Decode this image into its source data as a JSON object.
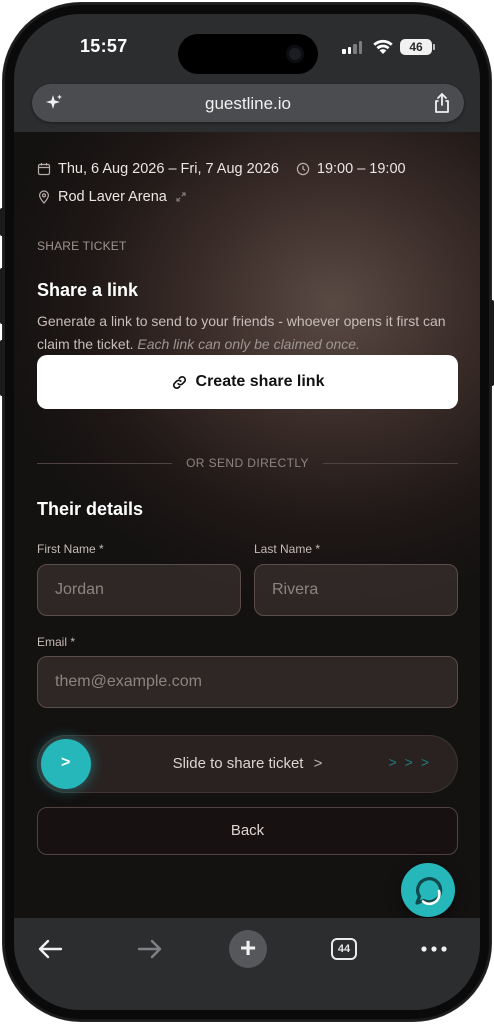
{
  "status_bar": {
    "time": "15:57",
    "battery": "46"
  },
  "browser": {
    "url": "guestline.io"
  },
  "event": {
    "dates": "Thu, 6 Aug 2026 – Fri, 7 Aug 2026",
    "time": "19:00 – 19:00",
    "venue": "Rod Laver Arena"
  },
  "share": {
    "section_label": "SHARE TICKET",
    "heading": "Share a link",
    "description": "Generate a link to send to your friends - whoever opens it first can claim the ticket.",
    "description_note": "Each link can only be claimed once.",
    "create_button_label": "Create share link"
  },
  "divider": {
    "text": "OR SEND DIRECTLY"
  },
  "details": {
    "heading": "Their details",
    "first_name_label": "First Name *",
    "first_name_placeholder": "Jordan",
    "last_name_label": "Last Name *",
    "last_name_placeholder": "Rivera",
    "email_label": "Email *",
    "email_placeholder": "them@example.com"
  },
  "slider": {
    "label": "Slide to share ticket",
    "chevron": ">",
    "trail": ">>>"
  },
  "back_button_label": "Back",
  "toolbar": {
    "tabs_count": "44"
  },
  "colors": {
    "accent": "#26b7ba",
    "browser_chrome": "#2b2d2f",
    "button_bg": "#ffffff"
  }
}
